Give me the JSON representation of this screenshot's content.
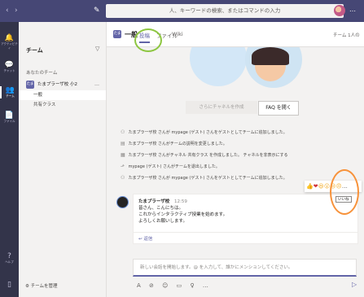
{
  "titlebar": {
    "back": "‹",
    "forward": "›",
    "compose_icon": "✎",
    "search_placeholder": "人、キーワードの検索、またはコマンドの入力",
    "more": "…"
  },
  "appbar": [
    {
      "icon": "🔔",
      "label": "アクティビティ"
    },
    {
      "icon": "💬",
      "label": "チャット"
    },
    {
      "icon": "👥",
      "label": "チーム"
    },
    {
      "icon": "📄",
      "label": "ファイル"
    }
  ],
  "appbar_bottom": [
    {
      "icon": "?",
      "label": "ヘルプ"
    },
    {
      "icon": "▯",
      "label": ""
    }
  ],
  "teampanel": {
    "title": "チーム",
    "filter_icon": "▽",
    "section": "あなたのチーム",
    "team_badge": "たま",
    "team_name": "たまプラーザ校 小2",
    "team_more": "…",
    "channels": [
      "一般",
      "共有クラス"
    ],
    "manage": "チームを管理"
  },
  "main": {
    "header_badge": "たま",
    "channel_name": "一般",
    "tabs": [
      "投稿",
      "ファイル",
      "Wiki"
    ],
    "right_info": "チーム 1人の",
    "btn_create_channel": "さらにチャネルを作成",
    "btn_faq": "FAQ を開く",
    "activities": [
      {
        "icon": "⚇",
        "text": "たまプラーザ校 さんが mypage (ゲスト) さんをゲストとしてチームに追加しました。"
      },
      {
        "icon": "▤",
        "text": "たまプラーザ校 さんがチームの説明を変更しました。"
      },
      {
        "icon": "▦",
        "text": "たまプラーザ校 さんがチャネル 共有クラス を作成しました。 チャネルを非表示にする"
      },
      {
        "icon": "⬏",
        "text": "mypage (ゲスト) さんがチームを退出しました。"
      },
      {
        "icon": "⚇",
        "text": "たまプラーザ校 さんが mypage (ゲスト) さんをゲストとしてチームに追加しました。"
      }
    ],
    "message": {
      "author": "たまプラーザ校",
      "time": "12:59",
      "lines": [
        "皆さん、こんにちは。",
        "これからインタラクティブ授業を始めます。",
        "よろしくお願いします。"
      ],
      "reply": "↩ 返信"
    },
    "reactions": [
      "👍",
      "❤",
      "😆",
      "😮",
      "😢",
      "😠"
    ],
    "reaction_more": "…",
    "reaction_tooltip": "いいね",
    "compose_placeholder": "新しい会話を開始します。@ を入力して、誰かにメンションしてください。",
    "toolbar_icons": "A ⊘ ☺ ▭ ♀ …",
    "send": "▷"
  }
}
